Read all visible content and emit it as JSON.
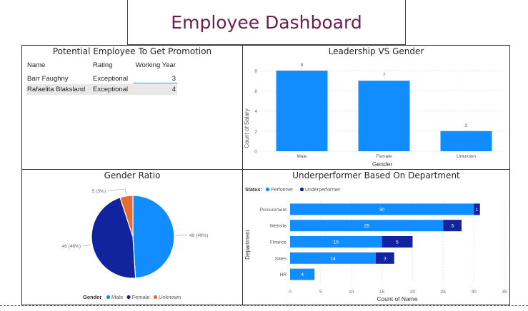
{
  "dashboard": {
    "title": "Employee Dashboard"
  },
  "promotion": {
    "title": "Potential Employee To Get Promotion",
    "columns": [
      "Name",
      "Rating",
      "Working Year"
    ],
    "rows": [
      {
        "name": "Barr Faughny",
        "rating": "Exceptional",
        "years": "3"
      },
      {
        "name": "Rafaelita Blaksland",
        "rating": "Exceptional",
        "years": "4"
      }
    ]
  },
  "chart_data": [
    {
      "type": "bar",
      "title": "Leadership VS Gender",
      "categories": [
        "Male",
        "Female",
        "Unknown"
      ],
      "values": [
        8,
        7,
        2
      ],
      "xlabel": "Gender",
      "ylabel": "Count of Salary",
      "ylim": [
        0,
        8
      ],
      "yticks": [
        0,
        2,
        4,
        6,
        8
      ],
      "color": "#118dff"
    },
    {
      "type": "pie",
      "title": "Gender Ratio",
      "legend_title": "Gender",
      "slices": [
        {
          "name": "Male",
          "value": 49,
          "label": "49 (49%)",
          "color": "#118dff"
        },
        {
          "name": "Female",
          "value": 46,
          "label": "46 (46%)",
          "color": "#12239e"
        },
        {
          "name": "Unknown",
          "value": 5,
          "label": "5 (5%)",
          "color": "#e66c37"
        }
      ]
    },
    {
      "type": "bar",
      "orientation": "horizontal",
      "stacked": true,
      "title": "Underperformer Based On Department",
      "legend_title": "Status",
      "categories": [
        "Procurement",
        "Website",
        "Finance",
        "Sales",
        "HR"
      ],
      "series": [
        {
          "name": "Performer",
          "color": "#118dff",
          "values": [
            30,
            25,
            15,
            14,
            4
          ]
        },
        {
          "name": "Underperformer",
          "color": "#12239e",
          "values": [
            1,
            3,
            5,
            3,
            0
          ]
        }
      ],
      "xlabel": "Count of Name",
      "ylabel": "Department",
      "xlim": [
        0,
        35
      ],
      "xticks": [
        0,
        5,
        10,
        15,
        20,
        25,
        30,
        35
      ]
    }
  ]
}
